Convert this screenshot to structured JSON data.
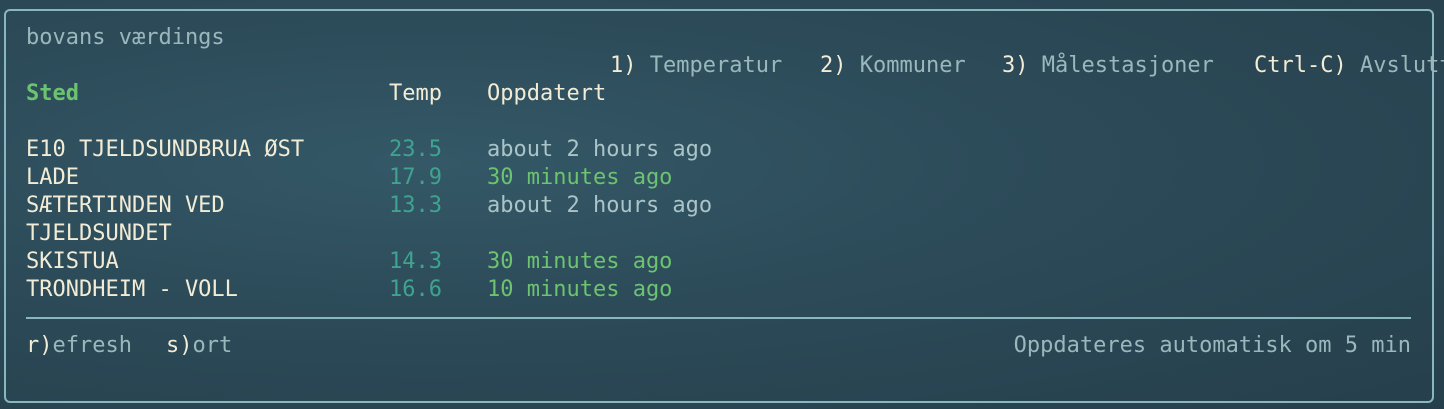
{
  "app": {
    "title": "bovans værdings"
  },
  "menu": [
    {
      "key": "1)",
      "label": "Temperatur"
    },
    {
      "key": "2)",
      "label": "Kommuner"
    },
    {
      "key": "3)",
      "label": "Målestasjoner"
    },
    {
      "key": "Ctrl-C)",
      "label": "Avslutt"
    }
  ],
  "table": {
    "headers": {
      "place": "Sted",
      "temp": "Temp",
      "updated": "Oppdatert"
    },
    "rows": [
      {
        "place": "E10 TJELDSUNDBRUA ØST",
        "temp": "23.5",
        "updated": "about 2 hours ago"
      },
      {
        "place": "LADE",
        "temp": "17.9",
        "updated": "30 minutes ago"
      },
      {
        "place": "SÆTERTINDEN VED",
        "temp": "13.3",
        "updated": "about 2 hours ago"
      },
      {
        "place": "TJELDSUNDET",
        "temp": "",
        "updated": ""
      },
      {
        "place": "SKISTUA",
        "temp": "14.3",
        "updated": "30 minutes ago"
      },
      {
        "place": "TRONDHEIM - VOLL",
        "temp": "16.6",
        "updated": "10 minutes ago"
      }
    ]
  },
  "footer": {
    "refresh_key": "r)",
    "refresh_label": "efresh",
    "sort_key": "s)",
    "sort_label": "ort",
    "status": "Oppdateres automatisk om 5 min"
  }
}
